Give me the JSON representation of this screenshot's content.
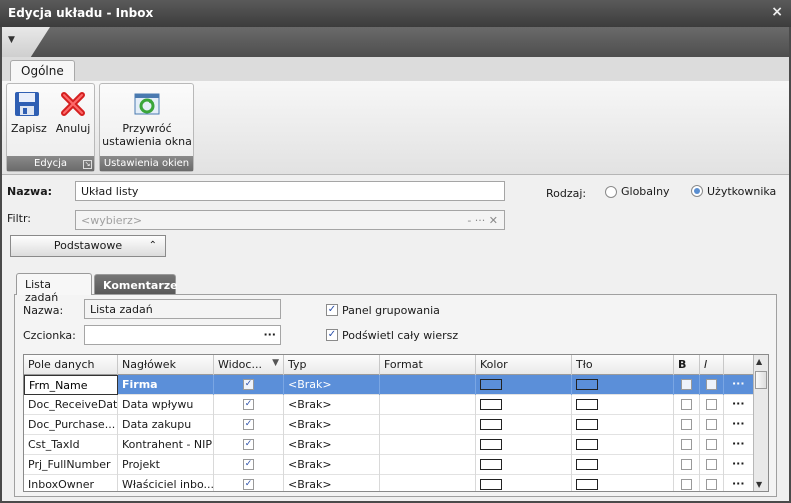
{
  "window": {
    "title": "Edycja układu - Inbox",
    "close_glyph": "×"
  },
  "ribbon": {
    "tab": "Ogólne",
    "groups": [
      {
        "label": "Edycja",
        "buttons": [
          {
            "label": "Zapisz",
            "icon": "save-icon"
          },
          {
            "label": "Anuluj",
            "icon": "cancel-icon"
          }
        ]
      },
      {
        "label": "Ustawienia okien",
        "buttons": [
          {
            "label": "Przywróć ustawienia okna",
            "icon": "restore-icon"
          }
        ]
      }
    ]
  },
  "form": {
    "name_label": "Nazwa:",
    "name_value": "Układ listy",
    "filter_label": "Filtr:",
    "filter_placeholder": "<wybierz>",
    "filter_buttons": "- ··· ✕",
    "kind_label": "Rodzaj:",
    "kind_options": [
      {
        "label": "Globalny",
        "selected": false
      },
      {
        "label": "Użytkownika",
        "selected": true
      }
    ],
    "section_button": "Podstawowe",
    "section_chevron": "«"
  },
  "tabs": [
    {
      "label": "Lista zadań",
      "active": true
    },
    {
      "label": "Komentarze",
      "active": false
    }
  ],
  "panel": {
    "name_label": "Nazwa:",
    "name_value": "Lista zadań",
    "font_label": "Czcionka:",
    "font_value": "",
    "font_button": "···",
    "group_panel_label": "Panel grupowania",
    "group_panel_checked": true,
    "highlight_row_label": "Podświetl cały wiersz",
    "highlight_row_checked": true
  },
  "grid": {
    "columns": [
      {
        "label": "Pole danych"
      },
      {
        "label": "Nagłówek"
      },
      {
        "label": "Widoc..."
      },
      {
        "label": "Typ"
      },
      {
        "label": "Format"
      },
      {
        "label": "Kolor"
      },
      {
        "label": "Tło"
      },
      {
        "label": "B"
      },
      {
        "label": "I"
      }
    ],
    "sort_indicator": "▼",
    "rows": [
      {
        "field": "Frm_Name",
        "header": "Firma",
        "visible": true,
        "type": "<Brak>",
        "format": "",
        "bold": false,
        "italic": false,
        "selected": true
      },
      {
        "field": "Doc_ReceiveDate",
        "header": "Data wpływu",
        "visible": true,
        "type": "<Brak>",
        "format": "",
        "bold": false,
        "italic": false,
        "selected": false
      },
      {
        "field": "Doc_Purchase...",
        "header": "Data zakupu",
        "visible": true,
        "type": "<Brak>",
        "format": "",
        "bold": false,
        "italic": false,
        "selected": false
      },
      {
        "field": "Cst_TaxId",
        "header": "Kontrahent - NIP",
        "visible": true,
        "type": "<Brak>",
        "format": "",
        "bold": false,
        "italic": false,
        "selected": false
      },
      {
        "field": "Prj_FullNumber",
        "header": "Projekt",
        "visible": true,
        "type": "<Brak>",
        "format": "",
        "bold": false,
        "italic": false,
        "selected": false
      },
      {
        "field": "InboxOwner",
        "header": "Właściciel inbo...",
        "visible": true,
        "type": "<Brak>",
        "format": "",
        "bold": false,
        "italic": false,
        "selected": false
      }
    ],
    "row_button": "···",
    "check_glyph": "✓"
  },
  "colors": {
    "selection": "#5b8fd9",
    "accent": "#3a6fb8",
    "titlebar": "#3c3c3c"
  }
}
